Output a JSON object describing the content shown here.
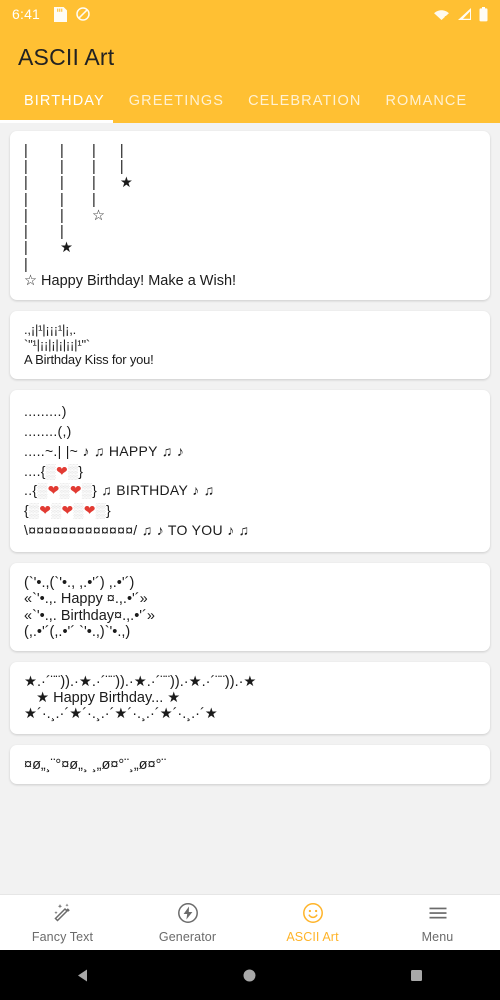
{
  "status_bar": {
    "time": "6:41",
    "left_icons": [
      "sd-card-icon",
      "do-not-disturb-icon"
    ],
    "right_icons": [
      "wifi-off-icon",
      "cell-signal-icon",
      "battery-icon"
    ]
  },
  "app_bar": {
    "title": "ASCII Art",
    "background_color": "#FFC033",
    "title_color": "#222222"
  },
  "tabs": {
    "active_index": 0,
    "indicator_color": "#FFFFFF",
    "items": [
      {
        "label": "BIRTHDAY"
      },
      {
        "label": "GREETINGS"
      },
      {
        "label": "CELEBRATION"
      },
      {
        "label": "ROMANCE"
      }
    ]
  },
  "cards": [
    {
      "name": "hanging-stars-wish",
      "art_lines": [
        "|        |       |      |",
        "|        |       |      |",
        "|        |       |      ★",
        "|        |       |",
        "|        |       ☆",
        "|        |",
        "|        ★",
        "|",
        "☆ Happy Birthday! Make a Wish!"
      ]
    },
    {
      "name": "birthday-kiss",
      "art_lines": [
        ".,¡|¹|¡¡¡¹|¡,.",
        "`\"¹|¡¡|¡|¡|¡¡|¹\"`",
        "A Birthday Kiss for you!"
      ]
    },
    {
      "name": "heart-cake",
      "art_lines": [
        ".........)",
        "........(,)",
        ".....~.| |~ ♪ ♫ HAPPY ♫ ♪",
        "....{▒❤▒}",
        "..{▒❤▒❤▒} ♫ BIRTHDAY ♪ ♫",
        "{▒❤▒❤▒❤▒}",
        "\\¤¤¤¤¤¤¤¤¤¤¤¤¤/ ♫ ♪ TO YOU ♪ ♫"
      ]
    },
    {
      "name": "swirl-frame-happy-birthday",
      "art_lines": [
        "(`'•.,(`'•., ,.•'´) ,.•'´)",
        "«`'•.,. Happy ¤.,.•'´»",
        "«`'•.,. Birthday¤.,.•'´»",
        "(,.•'´(,.•'´ `'•.,)`'•.,)"
      ]
    },
    {
      "name": "star-border-happy-birthday",
      "art_lines": [
        "★.·´¨¨)).·★.·´¨¨)).·★.·´¨¨)).·★.·´¨¨)).·★",
        "   ★ Happy Birthday... ★",
        "★´·.¸.·´★´·.¸.·´★´·.¸.·´★´·.¸.·´★"
      ]
    },
    {
      "name": "wave-ornament",
      "art_lines": [
        "¤ø„¸¨°¤ø„¸ ¸„ø¤°¨¸„ø¤°¨"
      ]
    }
  ],
  "bottom_nav": {
    "active_index": 2,
    "active_color": "#FFB429",
    "inactive_color": "#6B6B6B",
    "items": [
      {
        "label": "Fancy Text",
        "icon": "magic-wand-icon"
      },
      {
        "label": "Generator",
        "icon": "lightning-bolt-circle-icon"
      },
      {
        "label": "ASCII Art",
        "icon": "smiley-face-icon"
      },
      {
        "label": "Menu",
        "icon": "hamburger-menu-icon"
      }
    ]
  },
  "android_nav": {
    "background_color": "#000000",
    "items": [
      {
        "name": "back-button",
        "icon": "back-triangle-icon"
      },
      {
        "name": "home-button",
        "icon": "home-circle-icon"
      },
      {
        "name": "recents-button",
        "icon": "recents-square-icon"
      }
    ]
  }
}
